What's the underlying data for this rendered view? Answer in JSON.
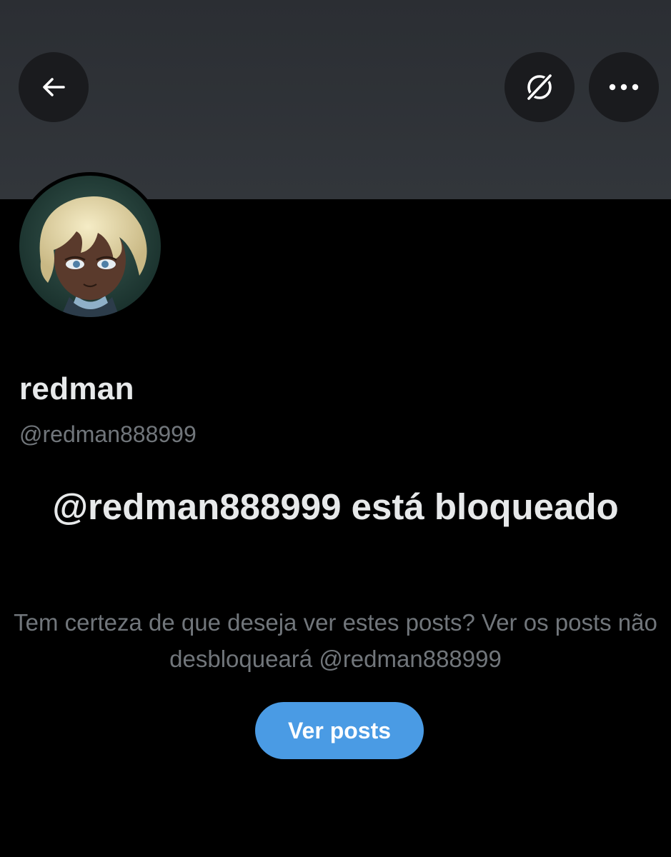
{
  "header": {
    "back_icon": "arrow-left-icon",
    "grok_icon": "grok-icon",
    "more_icon": "more-horizontal-icon"
  },
  "profile": {
    "display_name": "redman",
    "handle": "@redman888999"
  },
  "blocked": {
    "title": "@redman888999 está bloqueado",
    "description": "Tem certeza de que deseja ver estes posts? Ver os posts não desbloqueará @redman888999",
    "button_label": "Ver posts"
  },
  "colors": {
    "background": "#000000",
    "banner": "#2f3237",
    "button": "#4a9be4",
    "primary_text": "#e7e9ea",
    "secondary_text": "#71767b"
  }
}
